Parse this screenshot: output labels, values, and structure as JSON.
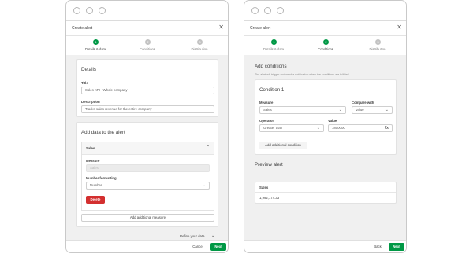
{
  "left": {
    "dialog_title": "Create alert",
    "steps": [
      {
        "label": "Details & data",
        "number": "1",
        "state": "done"
      },
      {
        "label": "Conditions",
        "number": "2",
        "state": "pending"
      },
      {
        "label": "Distribution",
        "number": "3",
        "state": "pending"
      }
    ],
    "details": {
      "title": "Details",
      "title_label": "Title",
      "title_value": "Sales KPI - Whole company",
      "description_label": "Description",
      "description_value": "Tracks sales revenue for the entire company"
    },
    "data_section": {
      "title": "Add data to the alert",
      "measure_header": "Sales",
      "measure_label": "Measure",
      "measure_value": "Sales",
      "formatting_label": "Number formatting",
      "formatting_value": "Number",
      "delete_label": "Delete",
      "add_measure_label": "Add additional measure"
    },
    "refine_label": "Refine your data",
    "cancel_label": "Cancel",
    "next_label": "Next"
  },
  "right": {
    "dialog_title": "Create alert",
    "steps": [
      {
        "label": "Details & data",
        "number": "1",
        "state": "done"
      },
      {
        "label": "Conditions",
        "number": "2",
        "state": "active"
      },
      {
        "label": "Distribution",
        "number": "3",
        "state": "pending"
      }
    ],
    "conditions": {
      "title": "Add conditions",
      "subtitle": "The alert will trigger and send a notification when the conditions are fulfilled.",
      "condition_title": "Condition 1",
      "measure_label": "Measure",
      "measure_value": "Sales",
      "compare_label": "Compare with",
      "compare_value": "Value",
      "operator_label": "Operator",
      "operator_value": "Greater than",
      "value_label": "Value",
      "value_value": "1800000",
      "fx_label": "fx",
      "add_condition_label": "Add additional condition"
    },
    "preview": {
      "title": "Preview alert",
      "column_header": "Sales",
      "value": "1,992,174.33"
    },
    "back_label": "Back",
    "next_label": "Next"
  },
  "colors": {
    "accent": "#009845",
    "danger": "#d32f2f",
    "background": "#f0f0f0"
  },
  "icons": {
    "close": "close-icon",
    "chevron_down": "chevron-down-icon",
    "chevron_up": "chevron-up-icon",
    "fx": "function-icon"
  }
}
